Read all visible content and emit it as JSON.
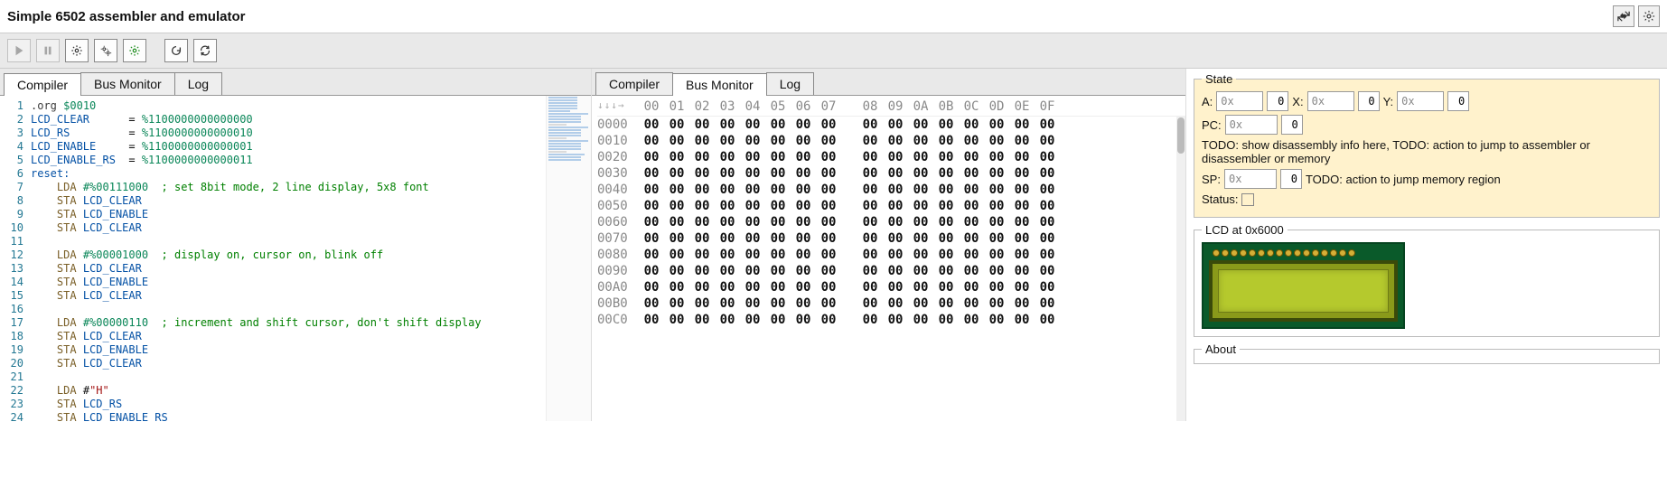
{
  "title": "Simple 6502 assembler and emulator",
  "header_buttons": {
    "collapse": "collapse-icon",
    "settings": "gear-icon"
  },
  "toolbar": [
    {
      "name": "run-button",
      "icon": "play",
      "disabled": true
    },
    {
      "name": "pause-button",
      "icon": "pause",
      "disabled": true
    },
    {
      "name": "step-button",
      "icon": "gear",
      "disabled": false
    },
    {
      "name": "step-over-button",
      "icon": "gear2",
      "disabled": false
    },
    {
      "name": "step-out-button",
      "icon": "gear-green",
      "disabled": false
    },
    {
      "sep": true
    },
    {
      "name": "reset-button",
      "icon": "reload",
      "disabled": false
    },
    {
      "name": "refresh-button",
      "icon": "refresh",
      "disabled": false
    }
  ],
  "tabs_left": {
    "items": [
      "Compiler",
      "Bus Monitor",
      "Log"
    ],
    "active": 0
  },
  "tabs_mid": {
    "items": [
      "Compiler",
      "Bus Monitor",
      "Log"
    ],
    "active": 1
  },
  "editor": {
    "lines": [
      {
        "n": 1,
        "tokens": [
          [
            ".org",
            "dir"
          ],
          [
            " ",
            "w"
          ],
          [
            "$0010",
            "num"
          ]
        ]
      },
      {
        "n": 2,
        "tokens": [
          [
            "LCD_CLEAR",
            "sym"
          ],
          [
            "      = ",
            "w"
          ],
          [
            "%1100000000000000",
            "num"
          ]
        ]
      },
      {
        "n": 3,
        "tokens": [
          [
            "LCD_RS",
            "sym"
          ],
          [
            "         = ",
            "w"
          ],
          [
            "%1100000000000010",
            "num"
          ]
        ]
      },
      {
        "n": 4,
        "tokens": [
          [
            "LCD_ENABLE",
            "sym"
          ],
          [
            "     = ",
            "w"
          ],
          [
            "%1100000000000001",
            "num"
          ]
        ]
      },
      {
        "n": 5,
        "tokens": [
          [
            "LCD_ENABLE_RS",
            "sym"
          ],
          [
            "  = ",
            "w"
          ],
          [
            "%1100000000000011",
            "num"
          ]
        ]
      },
      {
        "n": 6,
        "tokens": [
          [
            "reset:",
            "lbl"
          ]
        ]
      },
      {
        "n": 7,
        "tokens": [
          [
            "    ",
            "w"
          ],
          [
            "LDA",
            "op"
          ],
          [
            " ",
            "w"
          ],
          [
            "#%00111000",
            "num"
          ],
          [
            "  ",
            "w"
          ],
          [
            "; set 8bit mode, 2 line display, 5x8 font",
            "cmt"
          ]
        ]
      },
      {
        "n": 8,
        "tokens": [
          [
            "    ",
            "w"
          ],
          [
            "STA",
            "op"
          ],
          [
            " ",
            "w"
          ],
          [
            "LCD_CLEAR",
            "sym"
          ]
        ]
      },
      {
        "n": 9,
        "tokens": [
          [
            "    ",
            "w"
          ],
          [
            "STA",
            "op"
          ],
          [
            " ",
            "w"
          ],
          [
            "LCD_ENABLE",
            "sym"
          ]
        ]
      },
      {
        "n": 10,
        "tokens": [
          [
            "    ",
            "w"
          ],
          [
            "STA",
            "op"
          ],
          [
            " ",
            "w"
          ],
          [
            "LCD_CLEAR",
            "sym"
          ]
        ]
      },
      {
        "n": 11,
        "tokens": []
      },
      {
        "n": 12,
        "tokens": [
          [
            "    ",
            "w"
          ],
          [
            "LDA",
            "op"
          ],
          [
            " ",
            "w"
          ],
          [
            "#%00001000",
            "num"
          ],
          [
            "  ",
            "w"
          ],
          [
            "; display on, cursor on, blink off",
            "cmt"
          ]
        ]
      },
      {
        "n": 13,
        "tokens": [
          [
            "    ",
            "w"
          ],
          [
            "STA",
            "op"
          ],
          [
            " ",
            "w"
          ],
          [
            "LCD_CLEAR",
            "sym"
          ]
        ]
      },
      {
        "n": 14,
        "tokens": [
          [
            "    ",
            "w"
          ],
          [
            "STA",
            "op"
          ],
          [
            " ",
            "w"
          ],
          [
            "LCD_ENABLE",
            "sym"
          ]
        ]
      },
      {
        "n": 15,
        "tokens": [
          [
            "    ",
            "w"
          ],
          [
            "STA",
            "op"
          ],
          [
            " ",
            "w"
          ],
          [
            "LCD_CLEAR",
            "sym"
          ]
        ]
      },
      {
        "n": 16,
        "tokens": []
      },
      {
        "n": 17,
        "tokens": [
          [
            "    ",
            "w"
          ],
          [
            "LDA",
            "op"
          ],
          [
            " ",
            "w"
          ],
          [
            "#%00000110",
            "num"
          ],
          [
            "  ",
            "w"
          ],
          [
            "; increment and shift cursor, don't shift display",
            "cmt"
          ]
        ]
      },
      {
        "n": 18,
        "tokens": [
          [
            "    ",
            "w"
          ],
          [
            "STA",
            "op"
          ],
          [
            " ",
            "w"
          ],
          [
            "LCD_CLEAR",
            "sym"
          ]
        ]
      },
      {
        "n": 19,
        "tokens": [
          [
            "    ",
            "w"
          ],
          [
            "STA",
            "op"
          ],
          [
            " ",
            "w"
          ],
          [
            "LCD_ENABLE",
            "sym"
          ]
        ]
      },
      {
        "n": 20,
        "tokens": [
          [
            "    ",
            "w"
          ],
          [
            "STA",
            "op"
          ],
          [
            " ",
            "w"
          ],
          [
            "LCD_CLEAR",
            "sym"
          ]
        ]
      },
      {
        "n": 21,
        "tokens": []
      },
      {
        "n": 22,
        "tokens": [
          [
            "    ",
            "w"
          ],
          [
            "LDA",
            "op"
          ],
          [
            " ",
            "w"
          ],
          [
            "#",
            "w"
          ],
          [
            "\"H\"",
            "str"
          ]
        ]
      },
      {
        "n": 23,
        "tokens": [
          [
            "    ",
            "w"
          ],
          [
            "STA",
            "op"
          ],
          [
            " ",
            "w"
          ],
          [
            "LCD_RS",
            "sym"
          ]
        ]
      },
      {
        "n": 24,
        "tokens": [
          [
            "    ",
            "w"
          ],
          [
            "STA",
            "op"
          ],
          [
            " ",
            "w"
          ],
          [
            "LCD_ENABLE_RS",
            "sym"
          ]
        ]
      }
    ]
  },
  "hex": {
    "arrows": "↓↓↓→",
    "cols": [
      "00",
      "01",
      "02",
      "03",
      "04",
      "05",
      "06",
      "07",
      "08",
      "09",
      "0A",
      "0B",
      "0C",
      "0D",
      "0E",
      "0F"
    ],
    "rows": [
      {
        "addr": "0000",
        "vals": [
          "00",
          "00",
          "00",
          "00",
          "00",
          "00",
          "00",
          "00",
          "00",
          "00",
          "00",
          "00",
          "00",
          "00",
          "00",
          "00"
        ]
      },
      {
        "addr": "0010",
        "vals": [
          "00",
          "00",
          "00",
          "00",
          "00",
          "00",
          "00",
          "00",
          "00",
          "00",
          "00",
          "00",
          "00",
          "00",
          "00",
          "00"
        ]
      },
      {
        "addr": "0020",
        "vals": [
          "00",
          "00",
          "00",
          "00",
          "00",
          "00",
          "00",
          "00",
          "00",
          "00",
          "00",
          "00",
          "00",
          "00",
          "00",
          "00"
        ]
      },
      {
        "addr": "0030",
        "vals": [
          "00",
          "00",
          "00",
          "00",
          "00",
          "00",
          "00",
          "00",
          "00",
          "00",
          "00",
          "00",
          "00",
          "00",
          "00",
          "00"
        ]
      },
      {
        "addr": "0040",
        "vals": [
          "00",
          "00",
          "00",
          "00",
          "00",
          "00",
          "00",
          "00",
          "00",
          "00",
          "00",
          "00",
          "00",
          "00",
          "00",
          "00"
        ]
      },
      {
        "addr": "0050",
        "vals": [
          "00",
          "00",
          "00",
          "00",
          "00",
          "00",
          "00",
          "00",
          "00",
          "00",
          "00",
          "00",
          "00",
          "00",
          "00",
          "00"
        ]
      },
      {
        "addr": "0060",
        "vals": [
          "00",
          "00",
          "00",
          "00",
          "00",
          "00",
          "00",
          "00",
          "00",
          "00",
          "00",
          "00",
          "00",
          "00",
          "00",
          "00"
        ]
      },
      {
        "addr": "0070",
        "vals": [
          "00",
          "00",
          "00",
          "00",
          "00",
          "00",
          "00",
          "00",
          "00",
          "00",
          "00",
          "00",
          "00",
          "00",
          "00",
          "00"
        ]
      },
      {
        "addr": "0080",
        "vals": [
          "00",
          "00",
          "00",
          "00",
          "00",
          "00",
          "00",
          "00",
          "00",
          "00",
          "00",
          "00",
          "00",
          "00",
          "00",
          "00"
        ]
      },
      {
        "addr": "0090",
        "vals": [
          "00",
          "00",
          "00",
          "00",
          "00",
          "00",
          "00",
          "00",
          "00",
          "00",
          "00",
          "00",
          "00",
          "00",
          "00",
          "00"
        ]
      },
      {
        "addr": "00A0",
        "vals": [
          "00",
          "00",
          "00",
          "00",
          "00",
          "00",
          "00",
          "00",
          "00",
          "00",
          "00",
          "00",
          "00",
          "00",
          "00",
          "00"
        ]
      },
      {
        "addr": "00B0",
        "vals": [
          "00",
          "00",
          "00",
          "00",
          "00",
          "00",
          "00",
          "00",
          "00",
          "00",
          "00",
          "00",
          "00",
          "00",
          "00",
          "00"
        ]
      },
      {
        "addr": "00C0",
        "vals": [
          "00",
          "00",
          "00",
          "00",
          "00",
          "00",
          "00",
          "00",
          "00",
          "00",
          "00",
          "00",
          "00",
          "00",
          "00",
          "00"
        ]
      }
    ]
  },
  "state": {
    "legend": "State",
    "A_label": "A:",
    "A_prefix": "0x",
    "A_val": "0",
    "X_label": "X:",
    "X_prefix": "0x",
    "X_val": "0",
    "Y_label": "Y:",
    "Y_prefix": "0x",
    "Y_val": "0",
    "PC_label": "PC:",
    "PC_prefix": "0x",
    "PC_val": "0",
    "PC_note": "TODO: show disassembly info here, TODO: action to jump to assembler or disassembler or memory",
    "SP_label": "SP:",
    "SP_prefix": "0x",
    "SP_val": "0",
    "SP_note": "TODO: action to jump memory region",
    "Status_label": "Status:"
  },
  "lcd": {
    "legend": "LCD at 0x6000",
    "pins": 16
  },
  "about": {
    "legend": "About"
  }
}
